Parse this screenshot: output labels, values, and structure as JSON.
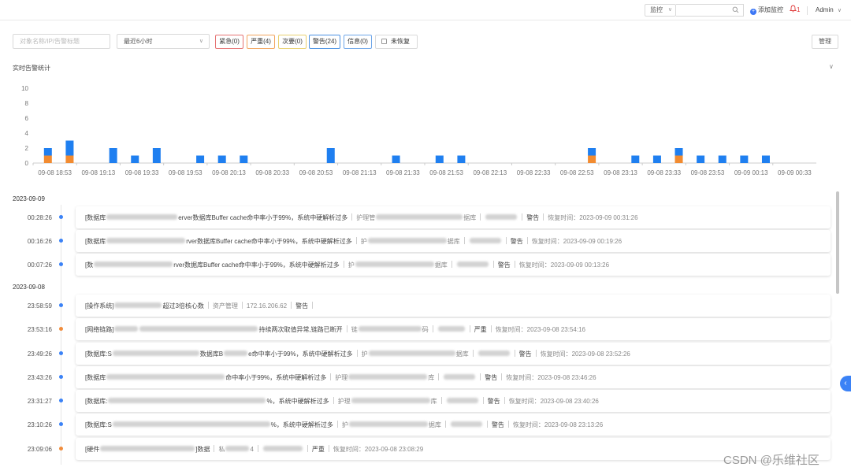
{
  "header": {
    "select_value": "监控",
    "search_placeholder": "",
    "add_monitor_label": "添加监控",
    "notification_count": "1",
    "user": "Admin"
  },
  "filters": {
    "search_placeholder": "对象名称/IP/告警标题",
    "time_range": "最近6小时",
    "tags": {
      "critical": "紧急(0)",
      "severe": "严重(4)",
      "minor": "次要(0)",
      "warning": "警告(24)",
      "info": "信息(0)"
    },
    "unrecovered_label": "未恢复",
    "manage_label": "管理"
  },
  "chart_section": {
    "title": "实时告警统计"
  },
  "chart_data": {
    "type": "bar",
    "stacked": true,
    "ylim": [
      0,
      10
    ],
    "yticks": [
      "0",
      "2",
      "4",
      "6",
      "8",
      "10"
    ],
    "xticks": [
      "09-08 18:53",
      "09-08 19:13",
      "09-08 19:33",
      "09-08 19:53",
      "09-08 20:13",
      "09-08 20:33",
      "09-08 20:53",
      "09-08 21:13",
      "09-08 21:33",
      "09-08 21:53",
      "09-08 22:13",
      "09-08 22:33",
      "09-08 22:53",
      "09-08 23:13",
      "09-08 23:33",
      "09-08 23:53",
      "09-09 00:13",
      "09-09 00:33"
    ],
    "colors": {
      "warning": "#1f7ff0",
      "severe": "#f28b30"
    },
    "bars": [
      {
        "slot": 1,
        "warning": 1,
        "severe": 1
      },
      {
        "slot": 2,
        "warning": 2,
        "severe": 1
      },
      {
        "slot": 4,
        "warning": 2,
        "severe": 0
      },
      {
        "slot": 5,
        "warning": 1,
        "severe": 0
      },
      {
        "slot": 6,
        "warning": 2,
        "severe": 0
      },
      {
        "slot": 8,
        "warning": 1,
        "severe": 0
      },
      {
        "slot": 9,
        "warning": 1,
        "severe": 0
      },
      {
        "slot": 10,
        "warning": 1,
        "severe": 0
      },
      {
        "slot": 14,
        "warning": 2,
        "severe": 0
      },
      {
        "slot": 17,
        "warning": 1,
        "severe": 0
      },
      {
        "slot": 19,
        "warning": 1,
        "severe": 0
      },
      {
        "slot": 20,
        "warning": 1,
        "severe": 0
      },
      {
        "slot": 26,
        "warning": 1,
        "severe": 1
      },
      {
        "slot": 28,
        "warning": 1,
        "severe": 0
      },
      {
        "slot": 29,
        "warning": 1,
        "severe": 0
      },
      {
        "slot": 30,
        "warning": 1,
        "severe": 1
      },
      {
        "slot": 31,
        "warning": 1,
        "severe": 0
      },
      {
        "slot": 32,
        "warning": 1,
        "severe": 0
      },
      {
        "slot": 33,
        "warning": 1,
        "severe": 0
      },
      {
        "slot": 34,
        "warning": 1,
        "severe": 0
      }
    ]
  },
  "timeline": {
    "days": [
      "2023-09-09",
      "2023-09-08"
    ],
    "entries": [
      {
        "time": "00:28:26",
        "color": "blue",
        "a": "[数据库",
        "b": "erver数据库Buffer cache命中率小于99%，系统中硬解析过多",
        "c": "护理管",
        "d": "据库",
        "level": "警告",
        "recover": "恢复时间：2023-09-09 00:31:26"
      },
      {
        "time": "00:16:26",
        "color": "blue",
        "a": "[数据库",
        "b": "rver数据库Buffer cache命中率小于99%，系统中硬解析过多",
        "c": "护",
        "d": "据库",
        "level": "警告",
        "recover": "恢复时间：2023-09-09 00:19:26"
      },
      {
        "time": "00:07:26",
        "color": "blue",
        "a": "[数",
        "b": "rver数据库Buffer cache命中率小于99%，系统中硬解析过多",
        "c": "护",
        "d": "据库",
        "level": "警告",
        "recover": "恢复时间：2023-09-09 00:13:26"
      },
      {
        "time": "23:58:59",
        "color": "blue",
        "a": "[操作系统]",
        "b": "超过3倍核心数",
        "c": "资产管理",
        "d": "172.16.206.62",
        "level": "警告",
        "recover": ""
      },
      {
        "time": "23:53:16",
        "color": "orange",
        "a": "[网络链路]",
        "b": "持续两次取值异常,链路已断开",
        "c": "链",
        "d": "码",
        "level": "严重",
        "recover": "恢复时间：2023-09-08 23:54:16"
      },
      {
        "time": "23:49:26",
        "color": "blue",
        "a": "[数据库:S",
        "b": "数据库B",
        "b2": "e命中率小于99%，系统中硬解析过多",
        "c": "护",
        "d": "据库",
        "level": "警告",
        "recover": "恢复时间：2023-09-08 23:52:26"
      },
      {
        "time": "23:43:26",
        "color": "blue",
        "a": "[数据库",
        "b": "命中率小于99%，系统中硬解析过多",
        "c": "护理",
        "d": "库",
        "level": "警告",
        "recover": "恢复时间：2023-09-08 23:46:26"
      },
      {
        "time": "23:31:27",
        "color": "blue",
        "a": "[数据库:",
        "b": "%，系统中硬解析过多",
        "c": "护理",
        "d": "库",
        "level": "警告",
        "recover": "恢复时间：2023-09-08 23:40:26"
      },
      {
        "time": "23:10:26",
        "color": "blue",
        "a": "[数据库:S",
        "b": "%，系统中硬解析过多",
        "c": "护",
        "d": "据库",
        "level": "警告",
        "recover": "恢复时间：2023-09-08 23:13:26"
      },
      {
        "time": "23:09:06",
        "color": "orange",
        "a": "[硬件",
        "b": "]数据",
        "c": "私",
        "d": "4",
        "level": "严重",
        "recover": "恢复时间：2023-09-08 23:08:29"
      }
    ]
  },
  "watermark": "CSDN @乐维社区"
}
